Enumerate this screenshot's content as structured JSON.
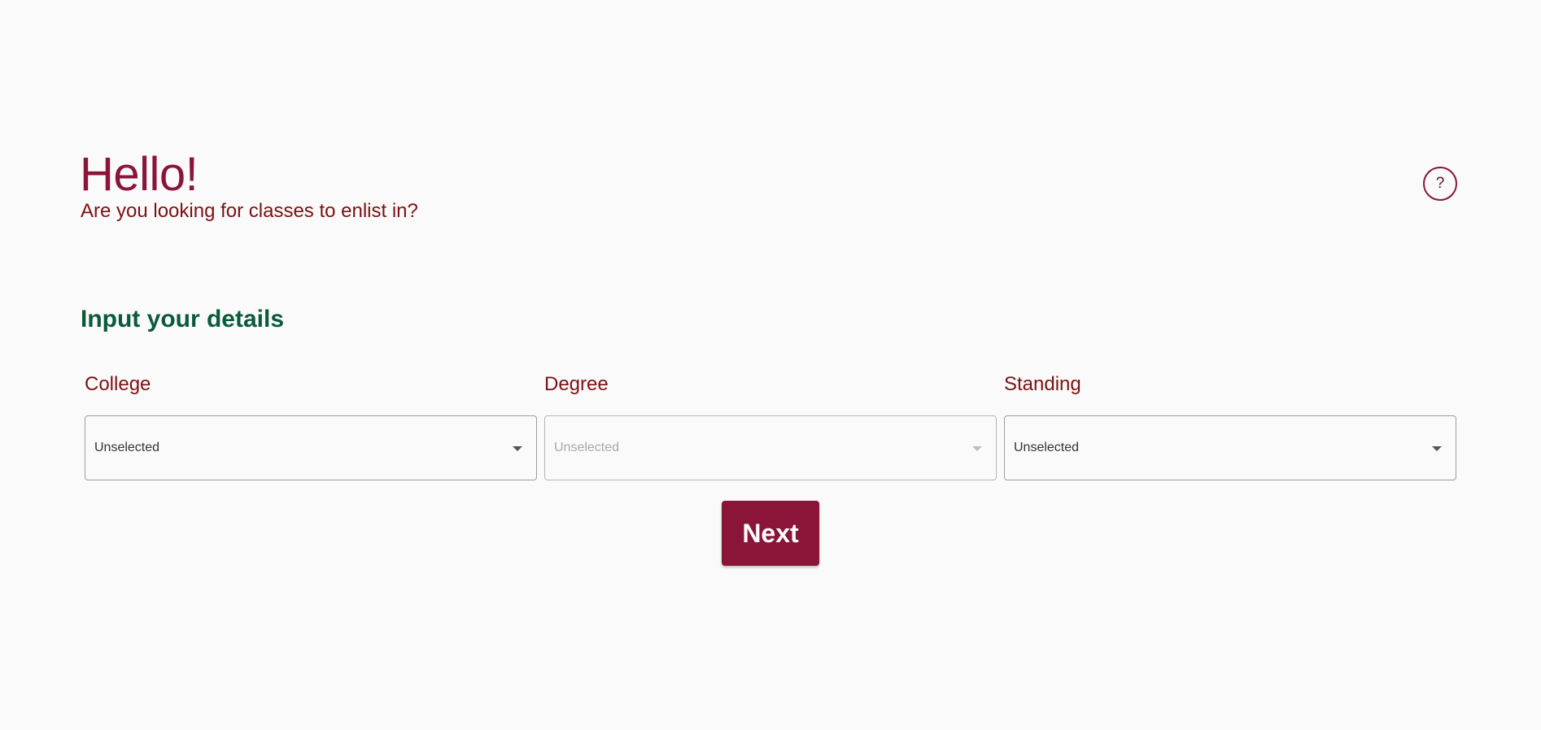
{
  "header": {
    "greeting": "Hello!",
    "subtitle": "Are you looking for classes to enlist in?",
    "help_label": "?"
  },
  "form": {
    "section_title": "Input your details",
    "fields": [
      {
        "label": "College",
        "value": "Unselected",
        "enabled": true
      },
      {
        "label": "Degree",
        "value": "Unselected",
        "enabled": false
      },
      {
        "label": "Standing",
        "value": "Unselected",
        "enabled": true
      }
    ],
    "next_label": "Next"
  },
  "colors": {
    "primary": "#8a1538",
    "label": "#7b1113",
    "section": "#0b5a3a",
    "background": "#fafafa"
  },
  "icons": {
    "help": "question-mark-icon",
    "dropdown": "chevron-down-icon"
  }
}
